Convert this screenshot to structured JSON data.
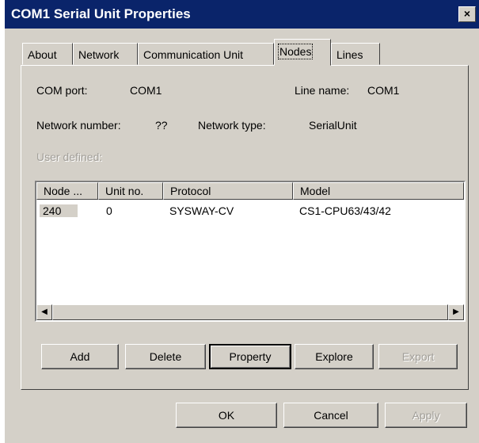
{
  "window": {
    "title": "COM1 Serial Unit Properties",
    "close_label": "×"
  },
  "tabs": [
    {
      "label": "About"
    },
    {
      "label": "Network"
    },
    {
      "label": "Communication Unit"
    },
    {
      "label": "Nodes",
      "active": true
    },
    {
      "label": "Lines"
    }
  ],
  "info": {
    "com_port_label": "COM port:",
    "com_port_value": "COM1",
    "line_name_label": "Line name:",
    "line_name_value": "COM1",
    "network_number_label": "Network number:",
    "network_number_value": "??",
    "network_type_label": "Network type:",
    "network_type_value": "SerialUnit",
    "user_defined_label": "User defined:"
  },
  "table": {
    "columns": [
      "Node ...",
      "Unit no.",
      "Protocol",
      "Model"
    ],
    "rows": [
      {
        "node": "240",
        "unit": "0",
        "protocol": "SYSWAY-CV",
        "model": "CS1-CPU63/43/42"
      }
    ]
  },
  "node_buttons": {
    "add": "Add",
    "delete": "Delete",
    "property": "Property",
    "explore": "Explore",
    "export": "Export"
  },
  "dialog_buttons": {
    "ok": "OK",
    "cancel": "Cancel",
    "apply": "Apply"
  }
}
